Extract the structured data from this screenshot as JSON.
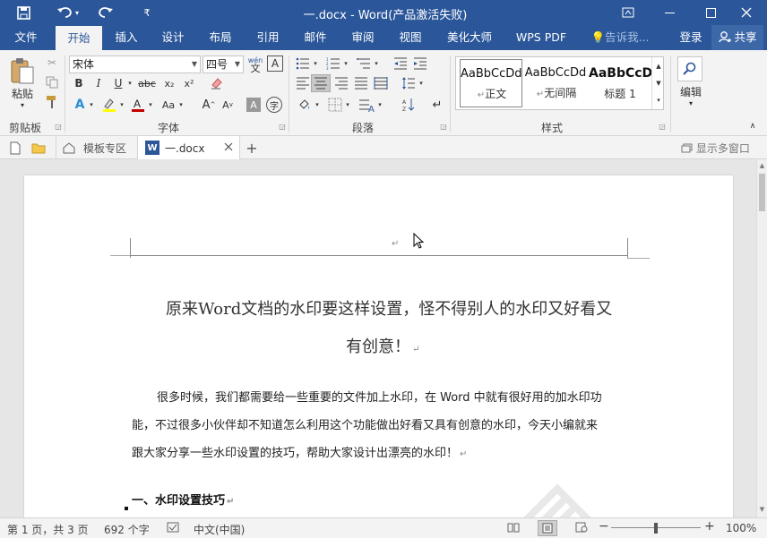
{
  "window": {
    "title": "一.docx - Word(产品激活失败)"
  },
  "quick_access": {
    "more": "₹"
  },
  "tabs": [
    "文件",
    "开始",
    "插入",
    "设计",
    "布局",
    "引用",
    "邮件",
    "审阅",
    "视图",
    "美化大师",
    "WPS PDF"
  ],
  "tell_me": "告诉我...",
  "login": "登录",
  "share": "共享",
  "clipboard": {
    "paste": "粘贴",
    "label": "剪贴板"
  },
  "font": {
    "name": "宋体",
    "size": "四号",
    "label": "字体",
    "wen": "wén",
    "wen_char": "文",
    "A_boxed": "A"
  },
  "paragraph": {
    "label": "段落"
  },
  "styles": {
    "label": "样式",
    "items": [
      {
        "preview": "AaBbCcDd",
        "name": "正文"
      },
      {
        "preview": "AaBbCcDd",
        "name": "无间隔"
      },
      {
        "preview": "AaBbCcD",
        "name": "标题 1"
      }
    ]
  },
  "edit": {
    "label": "编辑"
  },
  "doc_tabs": {
    "template": "模板专区",
    "doc": "一.docx",
    "multi_window": "显示多窗口"
  },
  "document": {
    "title_line1": "原来Word文档的水印要这样设置，怪不得别人的水印又好看又",
    "title_line2": "有创意！",
    "para_line1": "很多时候，我们都需要给一些重要的文件加上水印，在 Word 中就有很好用的加水印功",
    "para_line2": "能，不过很多小伙伴却不知道怎么利用这个功能做出好看又具有创意的水印，今天小编就来",
    "para_line3": "跟大家分享一些水印设置的技巧，帮助大家设计出漂亮的水印！",
    "section1": "一、水印设置技巧"
  },
  "status": {
    "page": "第 1 页，共 3 页",
    "words": "692 个字",
    "lang": "中文(中国)",
    "zoom": "100%"
  },
  "colors": {
    "accent": "#2b579a"
  }
}
